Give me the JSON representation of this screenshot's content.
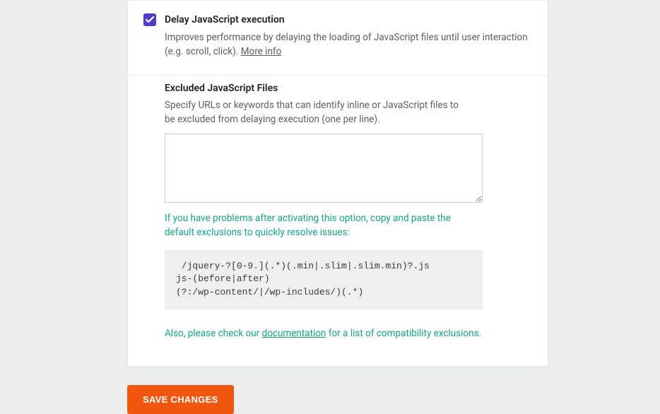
{
  "delay": {
    "title": "Delay JavaScript execution",
    "description_pre": "Improves performance by delaying the loading of JavaScript files until user interaction (e.g. scroll, click). ",
    "more_info": "More info",
    "checked": true
  },
  "excluded": {
    "title": "Excluded JavaScript Files",
    "description": "Specify URLs or keywords that can identify inline or JavaScript files to be excluded from delaying execution (one per line).",
    "help_text": "If you have problems after activating this option, copy and paste the default exclusions to quickly resolve issues:",
    "code_box": " /jquery-?[0-9.](.*)(.min|.slim|.slim.min)?.js\njs-(before|after)\n(?:/wp-content/|/wp-includes/)(.*)",
    "doc_pre": "Also, please check our ",
    "doc_link": "documentation",
    "doc_post": " for a list of compatibility exclusions."
  },
  "buttons": {
    "save": "SAVE CHANGES"
  }
}
